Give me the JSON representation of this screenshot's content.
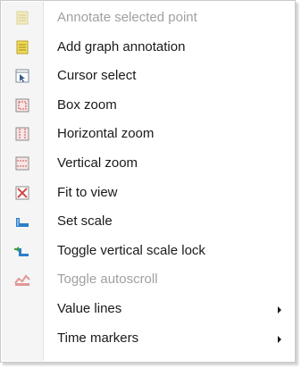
{
  "menu": {
    "items": [
      {
        "label": "Annotate selected point",
        "icon": "annotation-note-icon",
        "disabled": true,
        "submenu": false
      },
      {
        "label": "Add graph annotation",
        "icon": "annotation-note-icon",
        "disabled": false,
        "submenu": false
      },
      {
        "label": "Cursor select",
        "icon": "cursor-select-icon",
        "disabled": false,
        "submenu": false
      },
      {
        "label": "Box zoom",
        "icon": "box-zoom-icon",
        "disabled": false,
        "submenu": false
      },
      {
        "label": "Horizontal zoom",
        "icon": "horizontal-zoom-icon",
        "disabled": false,
        "submenu": false
      },
      {
        "label": "Vertical zoom",
        "icon": "vertical-zoom-icon",
        "disabled": false,
        "submenu": false
      },
      {
        "label": "Fit to view",
        "icon": "fit-to-view-icon",
        "disabled": false,
        "submenu": false
      },
      {
        "label": "Set scale",
        "icon": "set-scale-icon",
        "disabled": false,
        "submenu": false
      },
      {
        "label": "Toggle vertical scale lock",
        "icon": "scale-lock-icon",
        "disabled": false,
        "submenu": false
      },
      {
        "label": "Toggle autoscroll",
        "icon": "autoscroll-icon",
        "disabled": true,
        "submenu": false
      },
      {
        "label": "Value lines",
        "icon": "",
        "disabled": false,
        "submenu": true
      },
      {
        "label": "Time markers",
        "icon": "",
        "disabled": false,
        "submenu": true
      }
    ]
  },
  "colors": {
    "gutter": "#f5f5f5",
    "border": "#c9c9c9",
    "disabled_text": "#a0a0a0",
    "note_yellow": "#e8d870",
    "zoom_red": "#d24b4b",
    "scale_blue": "#2a7fc8"
  }
}
